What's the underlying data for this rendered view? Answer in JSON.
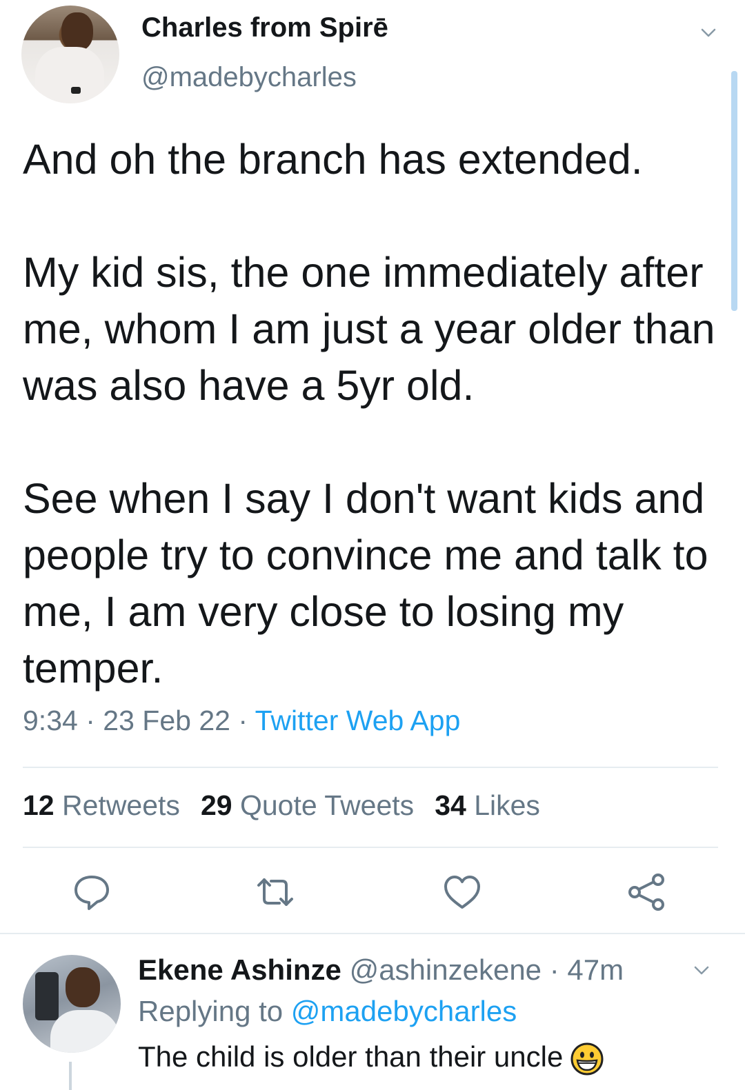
{
  "tweet": {
    "author_name": "Charles from Spirē",
    "author_handle": "@madebycharles",
    "text": "And oh the branch has extended.\n\nMy kid sis, the one immediately after me, whom I am just a year older than was also have a 5yr old.\n\nSee when I say I don't want kids and people try to convince me and talk to me, I am very close to losing my temper.",
    "time": "9:34",
    "date": "23 Feb 22",
    "source": "Twitter Web App",
    "separator": "·"
  },
  "stats": {
    "retweets_count": "12",
    "retweets_label": "Retweets",
    "quotes_count": "29",
    "quotes_label": "Quote Tweets",
    "likes_count": "34",
    "likes_label": "Likes"
  },
  "actions": {
    "reply_icon": "reply-icon",
    "retweet_icon": "retweet-icon",
    "like_icon": "heart-icon",
    "share_icon": "share-icon"
  },
  "reply": {
    "author_name": "Ekene Ashinze",
    "author_handle": "@ashinzekene",
    "separator": "·",
    "age": "47m",
    "replying_prefix": "Replying to",
    "replying_to": "@madebycharles",
    "text": "The child is older than their uncle"
  },
  "colors": {
    "accent": "#1da1f2",
    "secondary_text": "#657786",
    "divider": "#e6ecf0"
  }
}
